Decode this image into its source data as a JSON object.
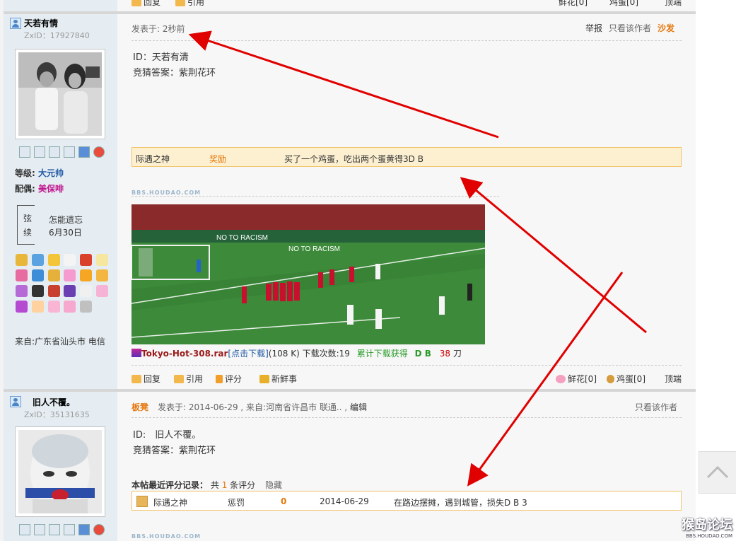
{
  "top_partial": {
    "reply": "回复",
    "quote": "引用",
    "flower": "鲜花[0]",
    "egg": "鸡蛋[0]",
    "top": "顶端"
  },
  "post1": {
    "username": "天若有情",
    "zxid": "ZxID：17927840",
    "level_label": "等级:",
    "level_value": "大元帅",
    "spouse_label": "配偶:",
    "spouse_value": "美保啡",
    "strings_chars": [
      "弦",
      "续"
    ],
    "status_text": "怎能遗忘",
    "status_date": "6月30日",
    "from": "来自:广东省汕头市 电信",
    "posted": "发表于: 2秒前",
    "report": "举报",
    "only_author": "只看该作者",
    "sofa": "沙发",
    "body_line1": "ID：天若有清",
    "body_line2": "竞猜答案：紫荆花环",
    "reward_user": "际遇之神",
    "reward_type": "奖励",
    "reward_text": "买了一个鸡蛋，吃出两个蛋黄得3D B",
    "watermark": "BBS.HOUDAO.COM",
    "attach_name": "Tokyo-Hot-308.rar",
    "attach_click": "[点击下载]",
    "attach_size": "(108 K)",
    "attach_count": "下载次数:19",
    "attach_earn": "累计下载获得",
    "attach_db": "D B",
    "attach_num": "38",
    "attach_unit": "刀",
    "image_banner1": "NO TO RACISM",
    "image_banner2": "NO TO RACISM",
    "toolbar": {
      "reply": "回复",
      "quote": "引用",
      "rate": "评分",
      "news": "新鲜事",
      "flower": "鲜花[0]",
      "egg": "鸡蛋[0]",
      "top": "顶端"
    }
  },
  "post2": {
    "username": "旧人不覆。",
    "zxid": "ZxID：35131635",
    "floor": "板凳",
    "posted": "发表于: 2014-06-29 , 来自:河南省许昌市 联通.. ,",
    "edit": "编辑",
    "only_author": "只看该作者",
    "body_line1": "ID:　旧人不覆。",
    "body_line2": "竞猜答案：紫荆花环",
    "rating_title": "本帖最近评分记录：",
    "rating_total_pre": "共",
    "rating_total_num": "1",
    "rating_total_post": "条评分",
    "rating_hide": "隐藏",
    "rating_user": "际遇之神",
    "rating_type": "惩罚",
    "rating_value": "0",
    "rating_date": "2014-06-29",
    "rating_text": "在路边摆摊，遇到城管，损失D B 3",
    "watermark": "BBS.HOUDAO.COM"
  },
  "logo": {
    "text": "猴岛论坛",
    "sub": "BBS.HOUDAO.COM"
  }
}
